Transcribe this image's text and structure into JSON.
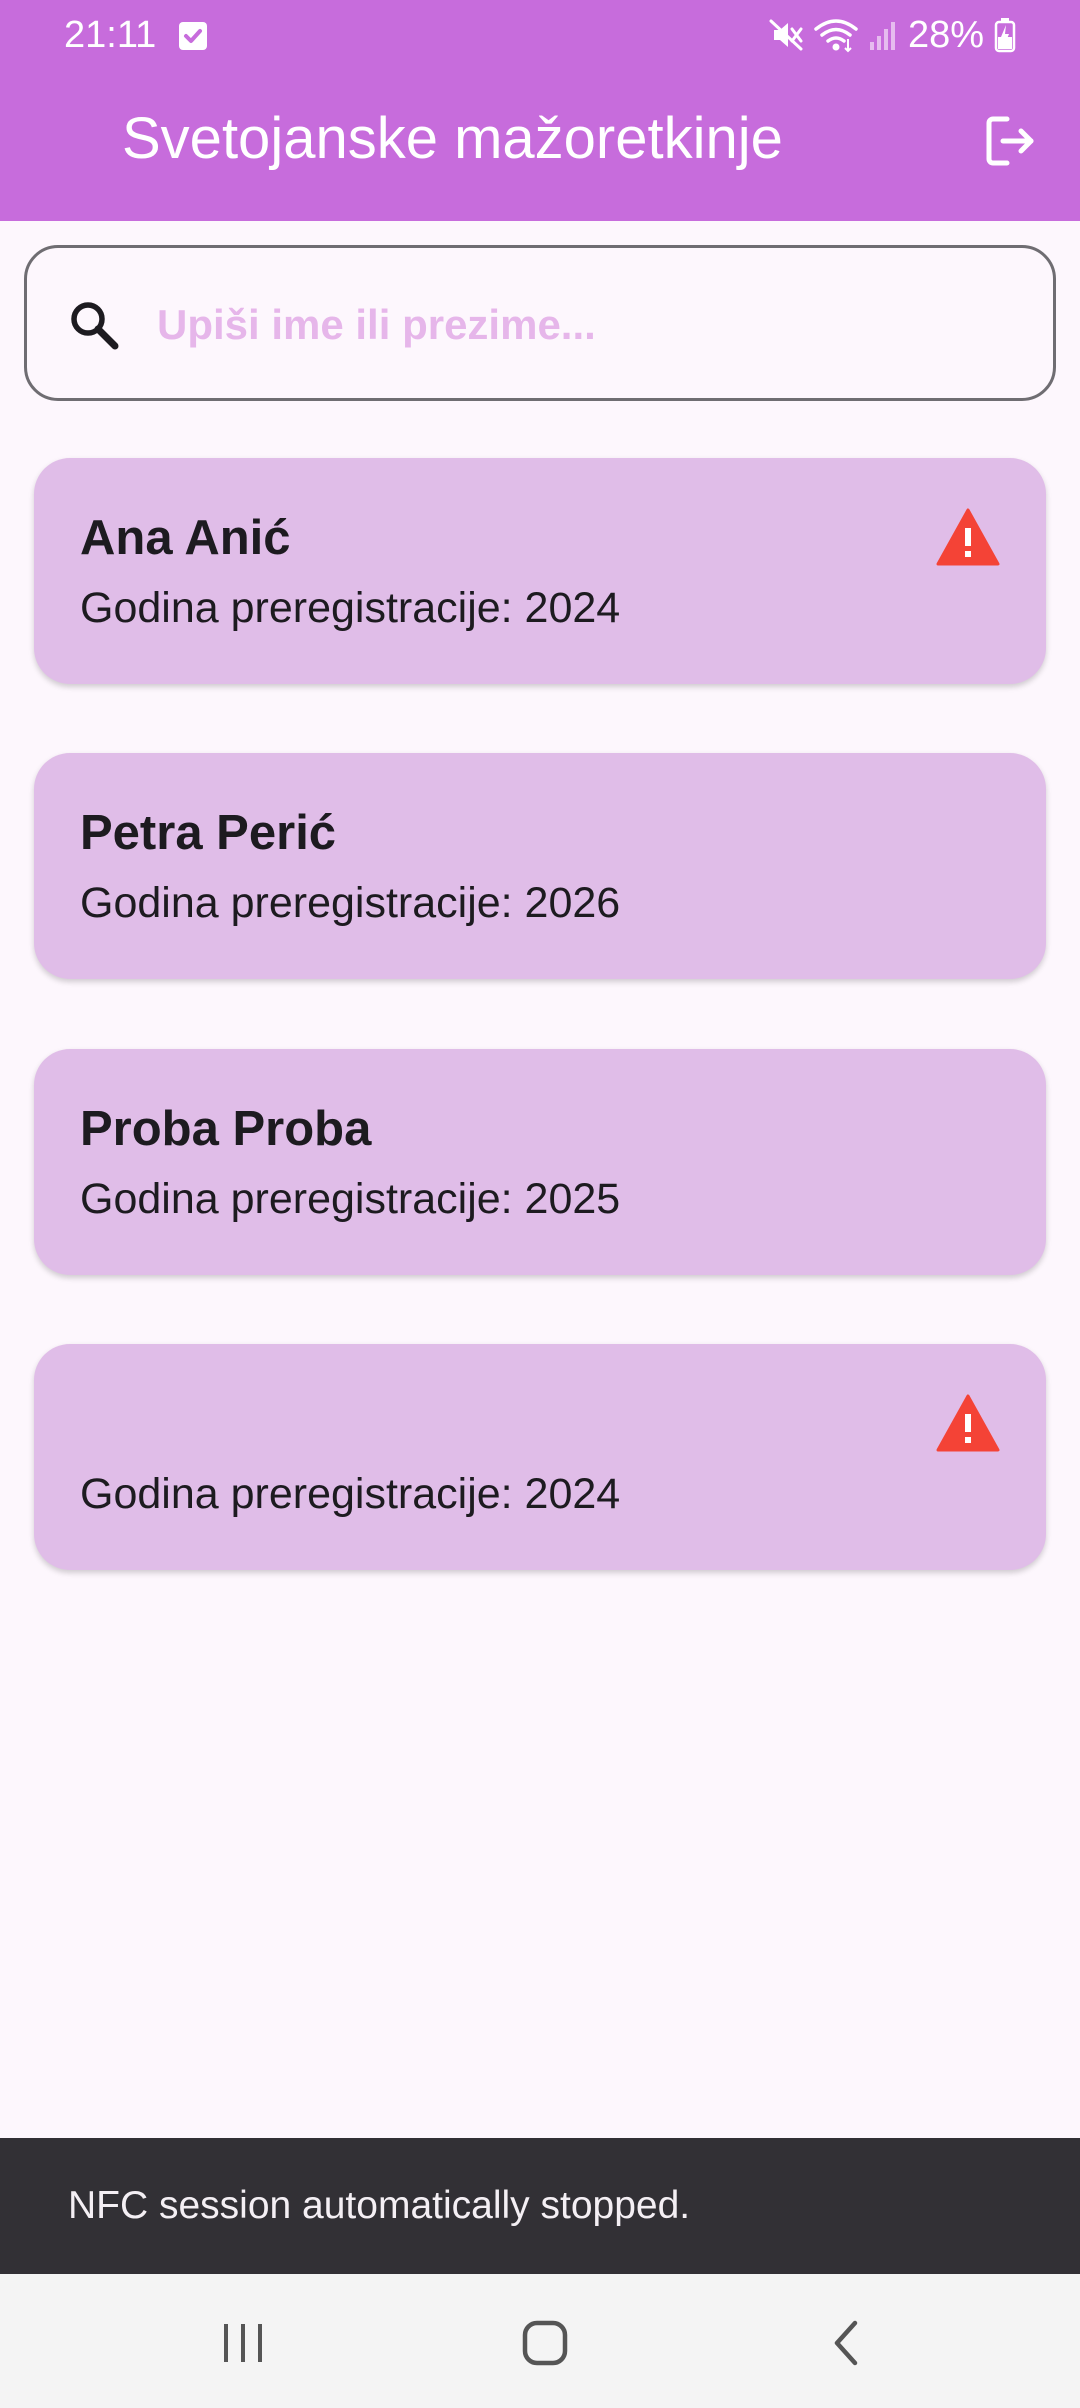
{
  "status_bar": {
    "time": "21:11",
    "battery": "28%"
  },
  "app_bar": {
    "title": "Svetojanske mažoretkinje",
    "logout_icon": "logout-icon"
  },
  "search": {
    "placeholder": "Upiši ime ili prezime...",
    "value": "",
    "icon": "search-icon"
  },
  "members": [
    {
      "name": "Ana Anić",
      "subtitle": "Godina preregistracije: 2024",
      "warning": true
    },
    {
      "name": "Petra Perić",
      "subtitle": "Godina preregistracije: 2026",
      "warning": false
    },
    {
      "name": "Proba Proba",
      "subtitle": "Godina preregistracije: 2025",
      "warning": false
    },
    {
      "name": "",
      "subtitle": "Godina preregistracije: 2024",
      "warning": true
    }
  ],
  "snackbar": {
    "message": "NFC session automatically stopped."
  },
  "colors": {
    "app_bar": "#c76cdc",
    "card": "#e0bde8",
    "warning": "#f44336",
    "background": "#fdf7fd",
    "snackbar": "#323035"
  }
}
